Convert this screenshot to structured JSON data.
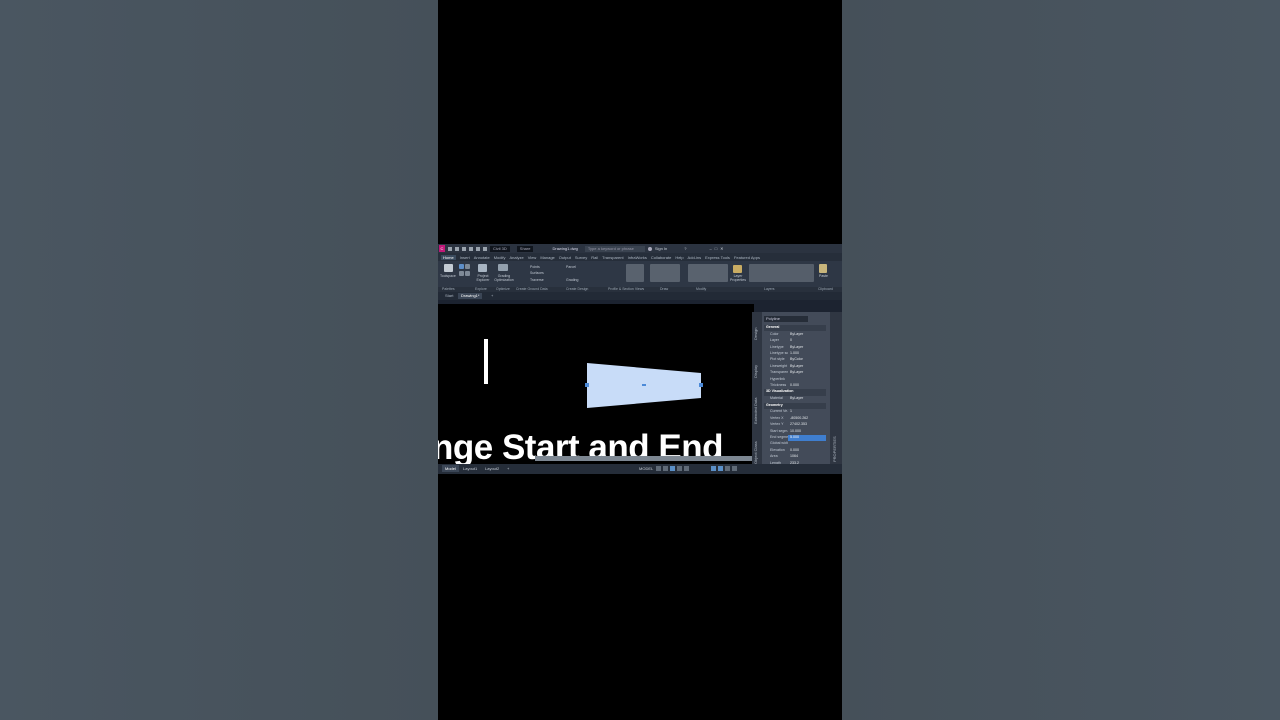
{
  "titlebar": {
    "workspace": "Civil 3D",
    "share": "Share",
    "filename": "Drawing1.dwg",
    "search_placeholder": "Type a keyword or phrase",
    "signin": "Sign In"
  },
  "ribbon_tabs": [
    "Home",
    "Insert",
    "Annotate",
    "Modify",
    "Analyze",
    "View",
    "Manage",
    "Output",
    "Survey",
    "Rail",
    "Transparent",
    "InfraWorks",
    "Collaborate",
    "Help",
    "Add-ins",
    "Express Tools",
    "Featured Apps"
  ],
  "ribbon": {
    "toolspace": "Toolspace",
    "project_explorer": "Project Explorer",
    "grading_optimization": "Grading Optimization",
    "points": "Points",
    "surfaces": "Surfaces",
    "traverse": "Traverse",
    "parcel": "Parcel",
    "grading": "Grading",
    "layer_properties": "Layer Properties",
    "paste": "Paste"
  },
  "panels": [
    "Palettes",
    "Explore",
    "Optimize",
    "Create Ground Data",
    "Create Design",
    "Profile & Section Views",
    "Draw",
    "Modify",
    "Layers",
    "Clipboard"
  ],
  "doc_tabs": {
    "start": "Start",
    "drawing": "Drawing1*"
  },
  "canvas": {
    "caption": "nge Start and End",
    "shape_color": "#c8dcf8"
  },
  "status": {
    "model": "Model",
    "layout1": "Layout1",
    "layout2": "Layout2",
    "mode": "MODEL"
  },
  "properties": {
    "object_type": "Polyline",
    "side_tabs": [
      "Design",
      "Display",
      "Extended Data",
      "Object Class"
    ],
    "right_label": "PROPERTIES",
    "rows": [
      {
        "k": "General",
        "v": "",
        "section": true
      },
      {
        "k": "Color",
        "v": "ByLayer"
      },
      {
        "k": "Layer",
        "v": "0"
      },
      {
        "k": "Linetype",
        "v": "ByLayer"
      },
      {
        "k": "Linetype sc...",
        "v": "1.000"
      },
      {
        "k": "Plot style",
        "v": "ByColor"
      },
      {
        "k": "Lineweight",
        "v": "ByLayer"
      },
      {
        "k": "Transparen...",
        "v": "ByLayer"
      },
      {
        "k": "Hyperlink",
        "v": ""
      },
      {
        "k": "Thickness",
        "v": "0.000"
      },
      {
        "k": "3D Visualization",
        "v": "",
        "section": true
      },
      {
        "k": "Material",
        "v": "ByLayer"
      },
      {
        "k": "Geometry",
        "v": "",
        "section": true
      },
      {
        "k": "Current Ve...",
        "v": "1"
      },
      {
        "k": "Vertex X",
        "v": "-80500.262"
      },
      {
        "k": "Vertex Y",
        "v": "27402.353"
      },
      {
        "k": "Start segm...",
        "v": "10.000"
      },
      {
        "k": "End segme...",
        "v": "5.000",
        "highlight": true
      },
      {
        "k": "Global width",
        "v": ""
      },
      {
        "k": "Elevation",
        "v": "0.000"
      },
      {
        "k": "Area",
        "v": "1064"
      },
      {
        "k": "Length",
        "v": "233.2"
      }
    ]
  }
}
